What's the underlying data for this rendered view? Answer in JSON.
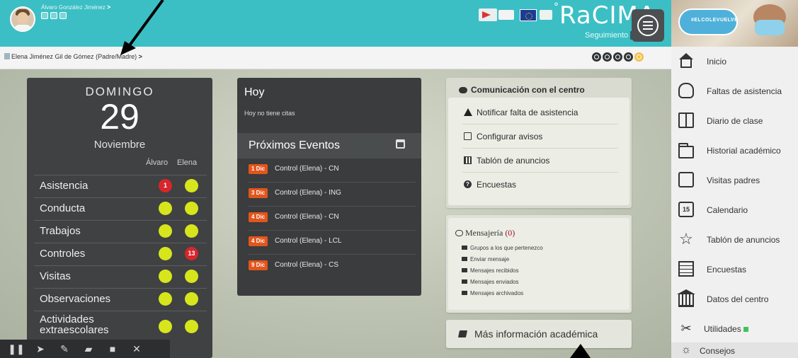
{
  "header": {
    "user_name": "Álvaro González Jiménez",
    "brand": "RaCIMA",
    "brand_sub": "Seguimiento",
    "promo_text": "#ELCOLEVUELVE"
  },
  "breadcrumb": {
    "parent_name": "Elena Jiménez Gil de Gómez",
    "role": "(Padre/Madre)"
  },
  "date_panel": {
    "weekday": "DOMINGO",
    "day": "29",
    "month": "Noviembre",
    "col_alvaro": "Álvaro",
    "col_elena": "Elena",
    "rows": [
      {
        "label": "Asistencia",
        "alvaro": "1",
        "elena": ""
      },
      {
        "label": "Conducta",
        "alvaro": "",
        "elena": ""
      },
      {
        "label": "Trabajos",
        "alvaro": "",
        "elena": ""
      },
      {
        "label": "Controles",
        "alvaro": "",
        "elena": "13"
      },
      {
        "label": "Visitas",
        "alvaro": "",
        "elena": ""
      },
      {
        "label": "Observaciones",
        "alvaro": "",
        "elena": ""
      },
      {
        "label": "Actividades extraescolares",
        "alvaro": "",
        "elena": ""
      }
    ]
  },
  "events": {
    "today_title": "Hoy",
    "today_text": "Hoy no tiene citas",
    "upcoming_title": "Próximos Eventos",
    "items": [
      {
        "date": "1 Dic",
        "text": "Control (Elena) - CN"
      },
      {
        "date": "3 Dic",
        "text": "Control (Elena) - ING"
      },
      {
        "date": "4 Dic",
        "text": "Control (Elena) - CN"
      },
      {
        "date": "4 Dic",
        "text": "Control (Elena) - LCL"
      },
      {
        "date": "9 Dic",
        "text": "Control (Elena) - CS"
      }
    ]
  },
  "communication": {
    "title": "Comunicación con el centro",
    "items": [
      "Notificar falta de asistencia",
      "Configurar avisos",
      "Tablón de anuncios",
      "Encuestas"
    ]
  },
  "messaging": {
    "title": "Mensajería",
    "count": "(0)",
    "items": [
      "Grupos a los que pertenezco",
      "Enviar mensaje",
      "Mensajes recibidos",
      "Mensajes enviados",
      "Mensajes archivados"
    ]
  },
  "more_info": "Más información académica",
  "sidebar": {
    "items": [
      {
        "label": "Inicio",
        "icon": "home-icon"
      },
      {
        "label": "Faltas de asistencia",
        "icon": "hand-icon"
      },
      {
        "label": "Diario de clase",
        "icon": "book-icon"
      },
      {
        "label": "Historial académico",
        "icon": "folder-icon"
      },
      {
        "label": "Visitas padres",
        "icon": "visits-icon"
      },
      {
        "label": "Calendario",
        "icon": "calendar-icon"
      },
      {
        "label": "Tablón de anuncios",
        "icon": "pushpin-icon"
      },
      {
        "label": "Encuestas",
        "icon": "list-icon"
      },
      {
        "label": "Datos del centro",
        "icon": "building-icon"
      },
      {
        "label": "Utilidades",
        "icon": "tools-icon"
      },
      {
        "label": "Consejos",
        "icon": "lightbulb-icon"
      }
    ],
    "calendar_icon_text": "15"
  },
  "colors": {
    "header_teal": "#3bbfc4",
    "panel_dark": "#3f4142",
    "status_yellow": "#d7e51d",
    "status_red": "#d7262c",
    "event_badge": "#e2561c"
  }
}
